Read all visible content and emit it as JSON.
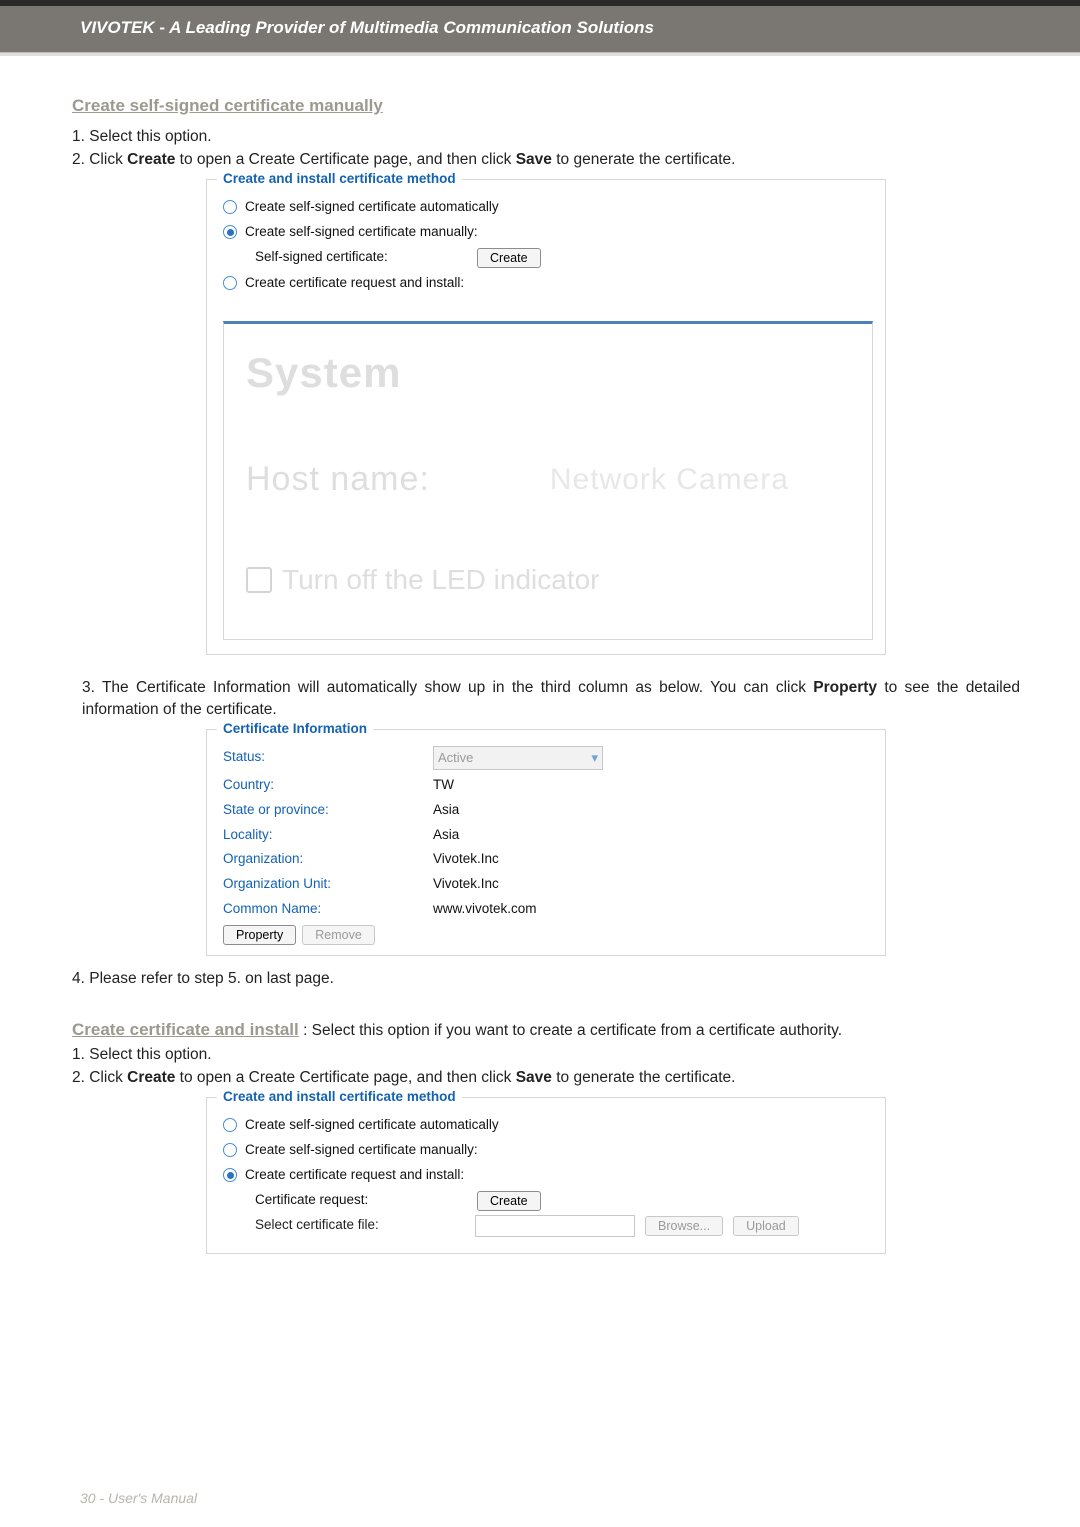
{
  "header": {
    "brand": "VIVOTEK - A Leading Provider of Multimedia Communication Solutions"
  },
  "sec1": {
    "title": "Create self-signed certificate manually",
    "step1": "1. Select this option.",
    "step2a": "2. Click ",
    "step2b": "Create",
    "step2c": " to open a Create Certificate page, and then click ",
    "step2d": "Save",
    "step2e": " to generate the certificate."
  },
  "fieldset1": {
    "legend": "Create and install certificate method",
    "r1": "Create self-signed certificate automatically",
    "r2": "Create self-signed certificate manually:",
    "sub1": "Self-signed certificate:",
    "createBtn": "Create",
    "r3": "Create certificate request and install:"
  },
  "watermark": {
    "system": "System",
    "host": "Host name:",
    "net": "Network Camera",
    "chk": "Turn off the LED indicator"
  },
  "step3": {
    "textA": "3. The Certificate Information will automatically show up in the third column as below. You can click ",
    "textB": "Property",
    "textC": " to see the detailed information of the certificate."
  },
  "certInfo": {
    "legend": "Certificate Information",
    "rows": [
      {
        "label": "Status:",
        "value": "Active",
        "type": "dropdown"
      },
      {
        "label": "Country:",
        "value": "TW"
      },
      {
        "label": "State or province:",
        "value": "Asia"
      },
      {
        "label": "Locality:",
        "value": "Asia"
      },
      {
        "label": "Organization:",
        "value": "Vivotek.Inc"
      },
      {
        "label": "Organization Unit:",
        "value": "Vivotek.Inc"
      },
      {
        "label": "Common Name:",
        "value": "www.vivotek.com"
      }
    ],
    "propertyBtn": "Property",
    "removeBtn": "Remove"
  },
  "step4": "4. Please refer to step 5. on last page.",
  "sec2": {
    "title": "Create certificate and install",
    "desc": " :  Select this option if you want to create a certificate from a certificate authority.",
    "step1": "1. Select this option.",
    "step2a": "2. Click ",
    "step2b": "Create",
    "step2c": " to open a Create Certificate page, and then click ",
    "step2d": "Save",
    "step2e": " to generate the certificate."
  },
  "fieldset2": {
    "legend": "Create and install certificate method",
    "r1": "Create self-signed certificate automatically",
    "r2": "Create self-signed certificate manually:",
    "r3": "Create certificate request and install:",
    "sub1": "Certificate request:",
    "createBtn": "Create",
    "sub2": "Select certificate file:",
    "browseBtn": "Browse...",
    "uploadBtn": "Upload"
  },
  "footer": "30 - User's Manual"
}
